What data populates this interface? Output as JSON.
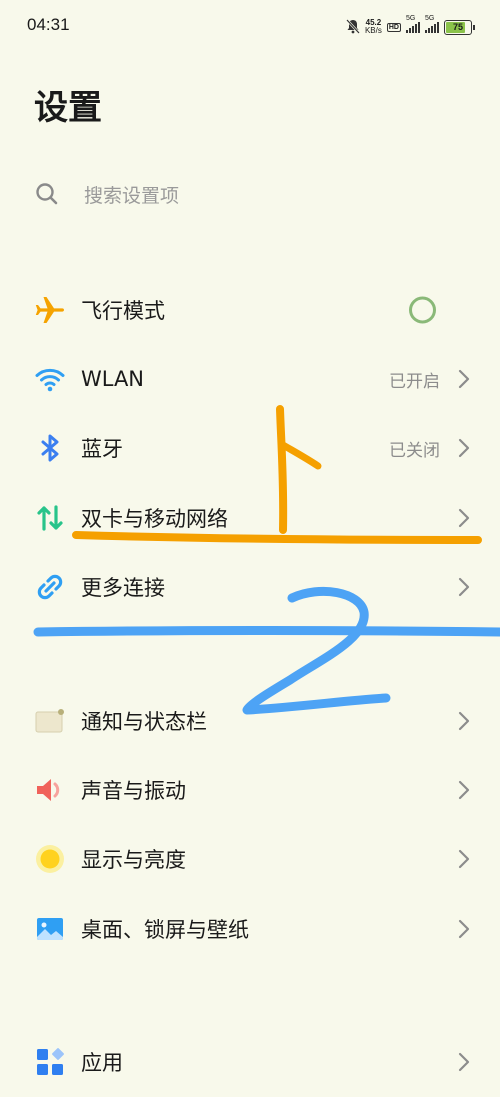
{
  "status_bar": {
    "time": "04:31",
    "speed_value": "45.2",
    "speed_unit": "KB/s",
    "hd_label": "HD",
    "sim1_network": "5G",
    "sim2_network": "5G",
    "battery": "75"
  },
  "page_title": "设置",
  "search": {
    "placeholder": "搜索设置项"
  },
  "groups": [
    [
      {
        "id": "airplane",
        "label": "飞行模式",
        "icon": "airplane-icon",
        "toggle": "off"
      },
      {
        "id": "wlan",
        "label": "WLAN",
        "value": "已开启",
        "icon": "wifi-icon"
      },
      {
        "id": "bluetooth",
        "label": "蓝牙",
        "value": "已关闭",
        "icon": "bluetooth-icon"
      },
      {
        "id": "dual-sim",
        "label": "双卡与移动网络",
        "icon": "mobile-data-icon"
      },
      {
        "id": "more-connections",
        "label": "更多连接",
        "icon": "link-icon"
      }
    ],
    [
      {
        "id": "notifications",
        "label": "通知与状态栏",
        "icon": "notification-icon"
      },
      {
        "id": "sound",
        "label": "声音与振动",
        "icon": "speaker-icon"
      },
      {
        "id": "display",
        "label": "显示与亮度",
        "icon": "brightness-icon"
      },
      {
        "id": "wallpaper",
        "label": "桌面、锁屏与壁纸",
        "icon": "wallpaper-icon"
      }
    ],
    [
      {
        "id": "apps",
        "label": "应用",
        "icon": "apps-icon"
      }
    ]
  ],
  "annotations": [
    {
      "shape": "handwritten character 上",
      "color": "#f5a000"
    },
    {
      "shape": "handwritten digit 2",
      "color": "#4da3f5"
    }
  ],
  "colors": {
    "background": "#f8f9eb",
    "airplane": "#f5a300",
    "wifi": "#2f9ff3",
    "bluetooth": "#3b7ff0",
    "mobile_data": "#28c48a",
    "toggle_off": "#8ab978",
    "sound": "#f0625a",
    "brightness": "#ffd21f"
  }
}
